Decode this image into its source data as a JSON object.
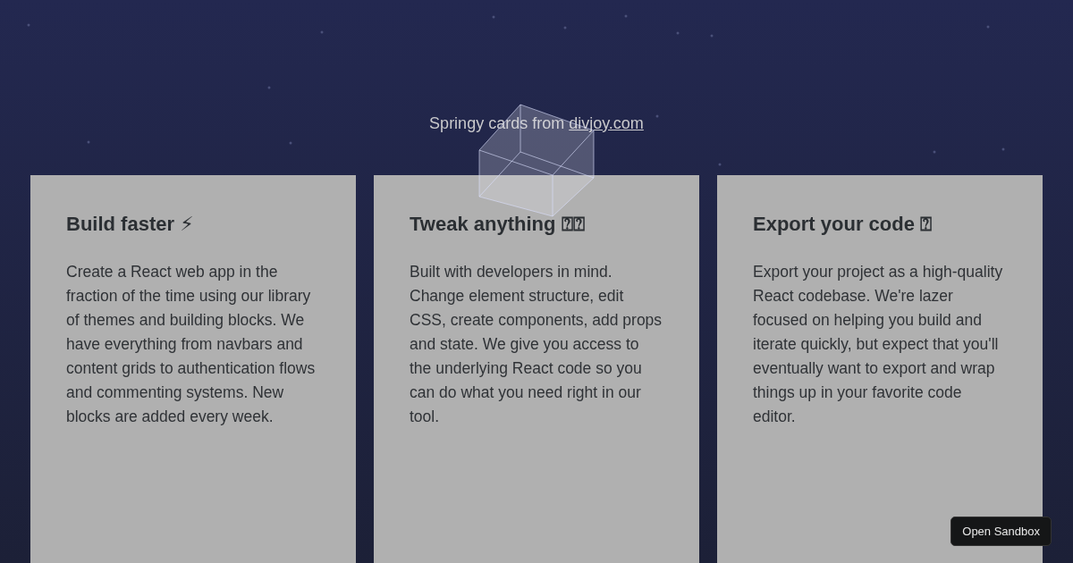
{
  "header": {
    "text": "Springy cards from ",
    "link": "divjoy.com"
  },
  "cards": [
    {
      "title": "Build faster ⚡",
      "body": "Create a React web app in the fraction of the time using our library of themes and building blocks. We have everything from navbars and content grids to authentication flows and commenting systems. New blocks are added every week."
    },
    {
      "title": "Tweak anything ⍰⍰",
      "body": "Built with developers in mind. Change element structure, edit CSS, create components, add props and state. We give you access to the underlying React code so you can do what you need right in our tool."
    },
    {
      "title": "Export your code ⍰",
      "body": "Export your project as a high-quality React codebase. We're lazer focused on helping you build and iterate quickly, but expect that you'll eventually want to export and wrap things up in your favorite code editor."
    }
  ],
  "sandbox_button": "Open Sandbox"
}
